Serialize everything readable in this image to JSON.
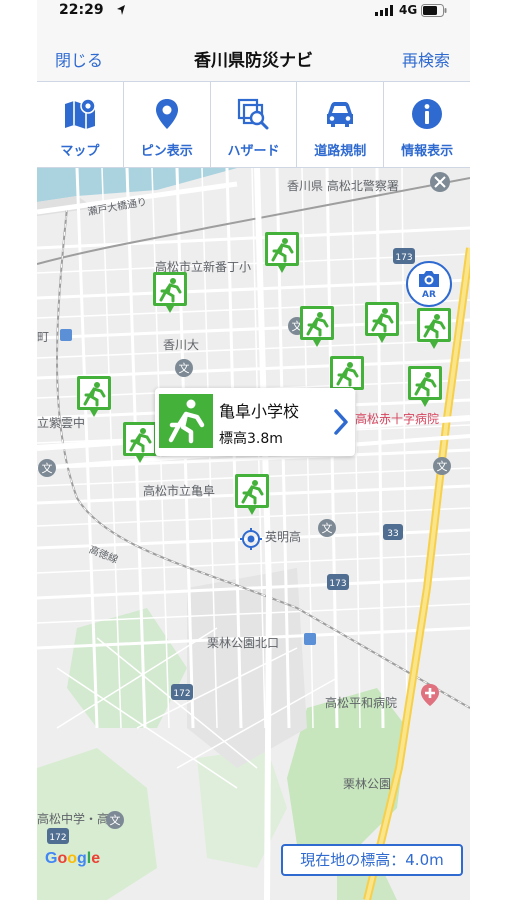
{
  "status": {
    "time": "22:29",
    "network": "4G"
  },
  "nav": {
    "close_label": "閉じる",
    "title": "香川県防災ナビ",
    "research_label": "再検索"
  },
  "toolbar": [
    {
      "label": "マップ",
      "icon": "map-icon"
    },
    {
      "label": "ピン表示",
      "icon": "pin-icon"
    },
    {
      "label": "ハザード",
      "icon": "hazard-icon"
    },
    {
      "label": "道路規制",
      "icon": "car-icon"
    },
    {
      "label": "情報表示",
      "icon": "info-icon"
    }
  ],
  "map": {
    "labels": {
      "police": "香川県 高松北警察署",
      "setoohashi": "瀬戸大橋通り",
      "shinbancho": "高松市立新番丁小",
      "kagawa_univ": "香川大",
      "machi": "町",
      "shiunchu": "立紫雲中",
      "redcross": "高松赤十字病院",
      "kameoka": "高松市立亀阜",
      "eimei": "英明高",
      "kotoku": "高徳線",
      "ritsurin_north": "栗林公園北口",
      "heiwa": "高松平和病院",
      "ritsurin": "栗林公園",
      "takamatsu_chu": "高松中学・高"
    },
    "route_badges": {
      "r173a": "173",
      "r33": "33",
      "r173b": "173",
      "r172a": "172",
      "r172b": "172"
    },
    "google_logo": "Google",
    "elevation_text": "現在地の標高：4.0m"
  },
  "callout": {
    "name": "亀阜小学校",
    "elevation": "標高3.8m"
  },
  "ar": {
    "label": "AR"
  },
  "colors": {
    "accent": "#2f6ad0",
    "shelter": "#44b13a",
    "road_major": "#f6d04d"
  }
}
